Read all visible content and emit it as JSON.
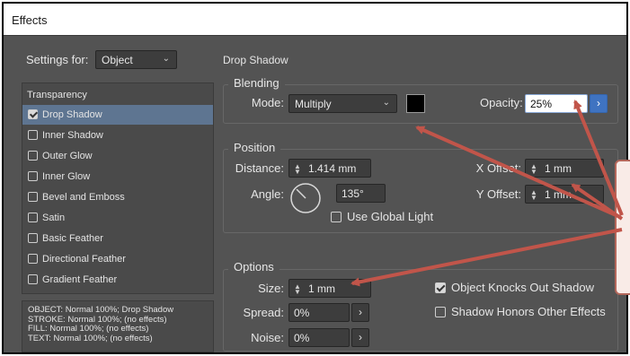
{
  "window": {
    "title": "Effects"
  },
  "settings_for": {
    "label": "Settings for:",
    "value": "Object"
  },
  "section_title": "Drop Shadow",
  "effects_list": {
    "header": "Transparency",
    "items": [
      {
        "label": "Drop Shadow",
        "checked": true,
        "selected": true
      },
      {
        "label": "Inner Shadow",
        "checked": false,
        "selected": false
      },
      {
        "label": "Outer Glow",
        "checked": false,
        "selected": false
      },
      {
        "label": "Inner Glow",
        "checked": false,
        "selected": false
      },
      {
        "label": "Bevel and Emboss",
        "checked": false,
        "selected": false
      },
      {
        "label": "Satin",
        "checked": false,
        "selected": false
      },
      {
        "label": "Basic Feather",
        "checked": false,
        "selected": false
      },
      {
        "label": "Directional Feather",
        "checked": false,
        "selected": false
      },
      {
        "label": "Gradient Feather",
        "checked": false,
        "selected": false
      }
    ]
  },
  "summary": [
    "OBJECT: Normal 100%; Drop Shadow",
    "STROKE: Normal 100%; (no effects)",
    "FILL: Normal 100%; (no effects)",
    "TEXT: Normal 100%; (no effects)"
  ],
  "blending": {
    "title": "Blending",
    "mode_label": "Mode:",
    "mode_value": "Multiply",
    "color": "#000000",
    "opacity_label": "Opacity:",
    "opacity_value": "25%"
  },
  "position": {
    "title": "Position",
    "distance_label": "Distance:",
    "distance_value": "1.414 mm",
    "angle_label": "Angle:",
    "angle_value": "135°",
    "angle_degrees": 135,
    "use_global_light_label": "Use Global Light",
    "use_global_light": false,
    "x_offset_label": "X Offset:",
    "x_offset_value": "1 mm",
    "y_offset_label": "Y Offset:",
    "y_offset_value": "1 mm"
  },
  "options": {
    "title": "Options",
    "size_label": "Size:",
    "size_value": "1 mm",
    "spread_label": "Spread:",
    "spread_value": "0%",
    "noise_label": "Noise:",
    "noise_value": "0%",
    "knocks_out_label": "Object Knocks Out Shadow",
    "knocks_out": true,
    "honors_effects_label": "Shadow Honors Other Effects",
    "honors_effects": false
  },
  "annotation": {
    "arrow_color": "#c1554a",
    "callout_border": "#b3665a"
  },
  "icons": {
    "dropdown": "chevron-down-icon",
    "spin": "spinner-icon",
    "more": "chevron-right-icon"
  }
}
